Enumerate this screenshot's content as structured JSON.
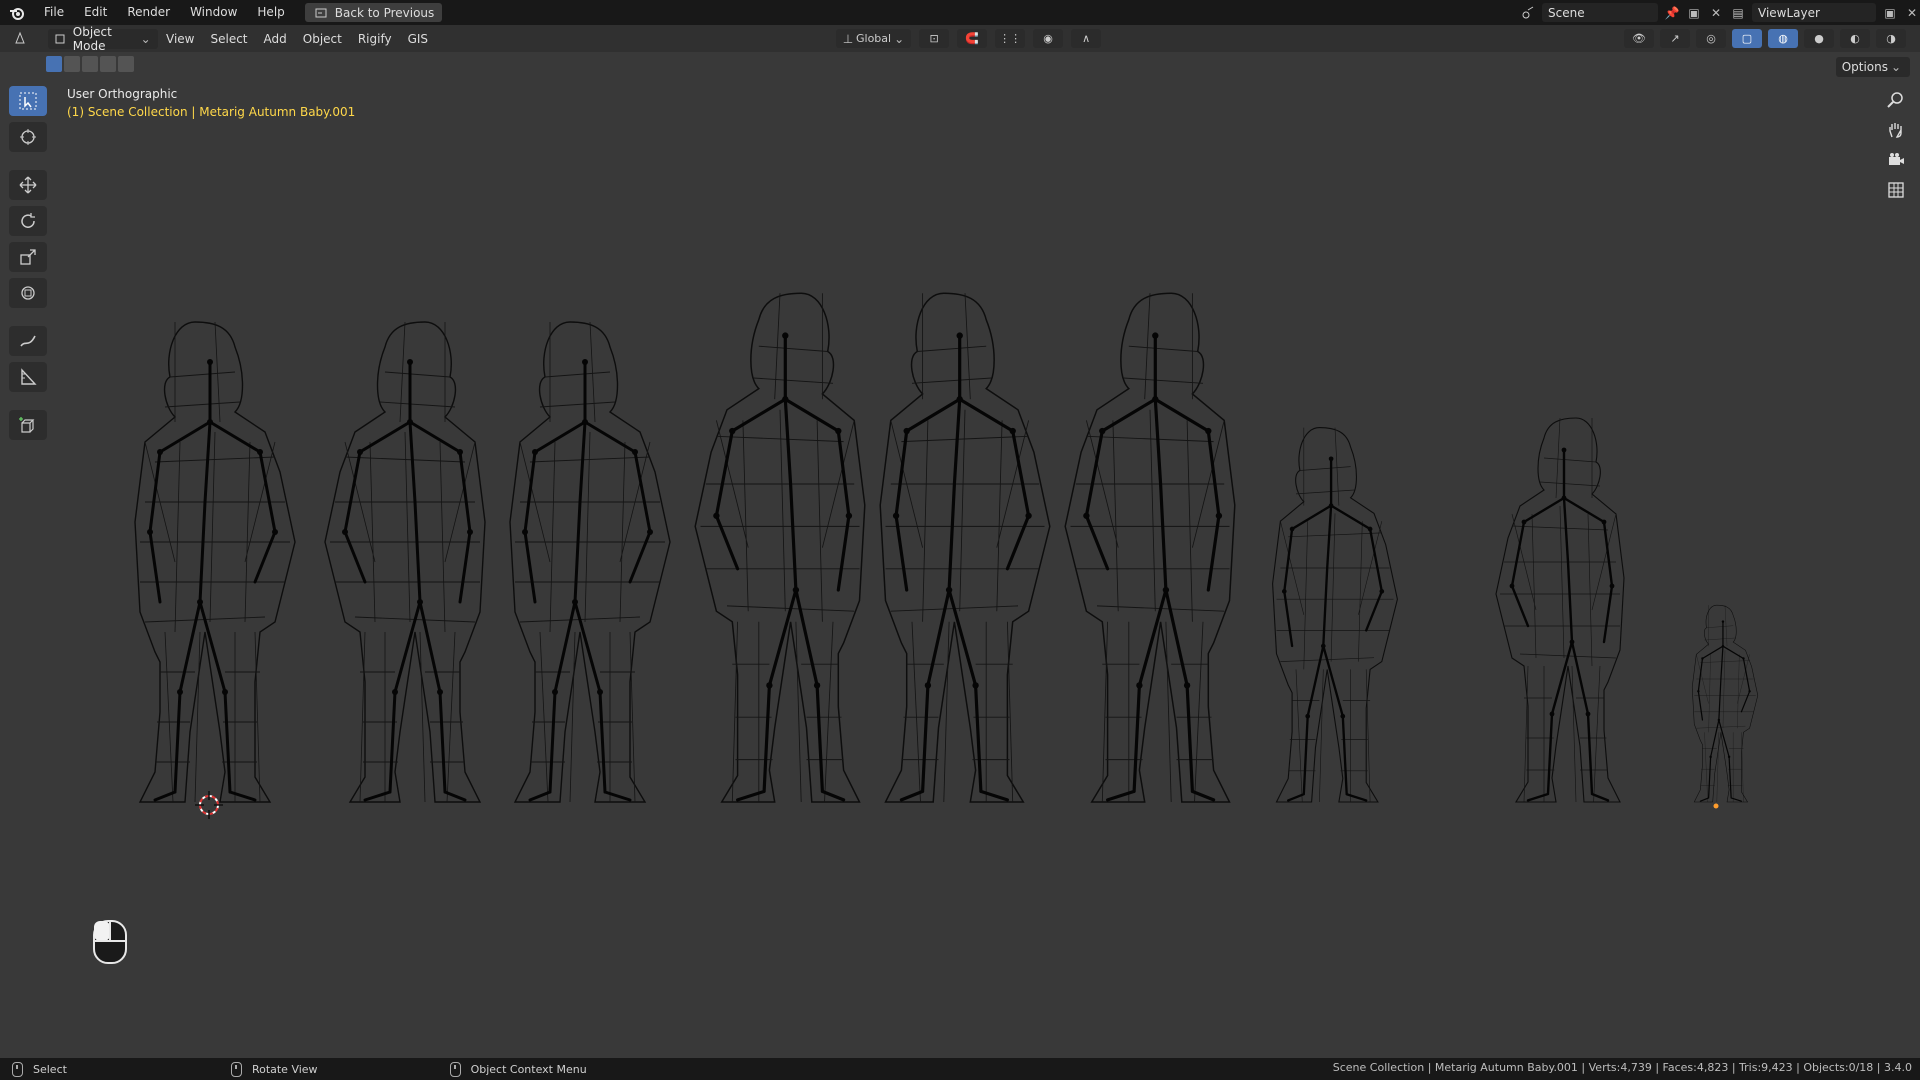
{
  "topbar": {
    "menus": [
      "File",
      "Edit",
      "Render",
      "Window",
      "Help"
    ],
    "back_button": "Back to Previous",
    "scene_name": "Scene",
    "viewlayer_name": "ViewLayer"
  },
  "header": {
    "mode": "Object Mode",
    "menus": [
      "View",
      "Select",
      "Add",
      "Object",
      "Rigify",
      "GIS"
    ],
    "transform_orientation": "Global",
    "options_label": "Options"
  },
  "viewport": {
    "view_name": "User Orthographic",
    "collection_line": "(1) Scene Collection | Metarig Autumn Baby.001"
  },
  "status": {
    "select": "Select",
    "rotate_view": "Rotate View",
    "context_menu": "Object Context Menu",
    "stats": "Scene Collection | Metarig Autumn Baby.001 | Verts:4,739 | Faces:4,823 | Tris:9,423 | Objects:0/18 | 3.4.0"
  },
  "figures": [
    {
      "scale": 1.0
    },
    {
      "scale": 1.0
    },
    {
      "scale": 1.0
    },
    {
      "scale": 1.06
    },
    {
      "scale": 1.06
    },
    {
      "scale": 1.06
    },
    {
      "scale": 0.78
    },
    {
      "scale": 0.8
    },
    {
      "scale": 0.41
    }
  ],
  "colors": {
    "accent": "#4772b3",
    "info_text": "#ffd84a",
    "viewport_bg": "#393939"
  }
}
